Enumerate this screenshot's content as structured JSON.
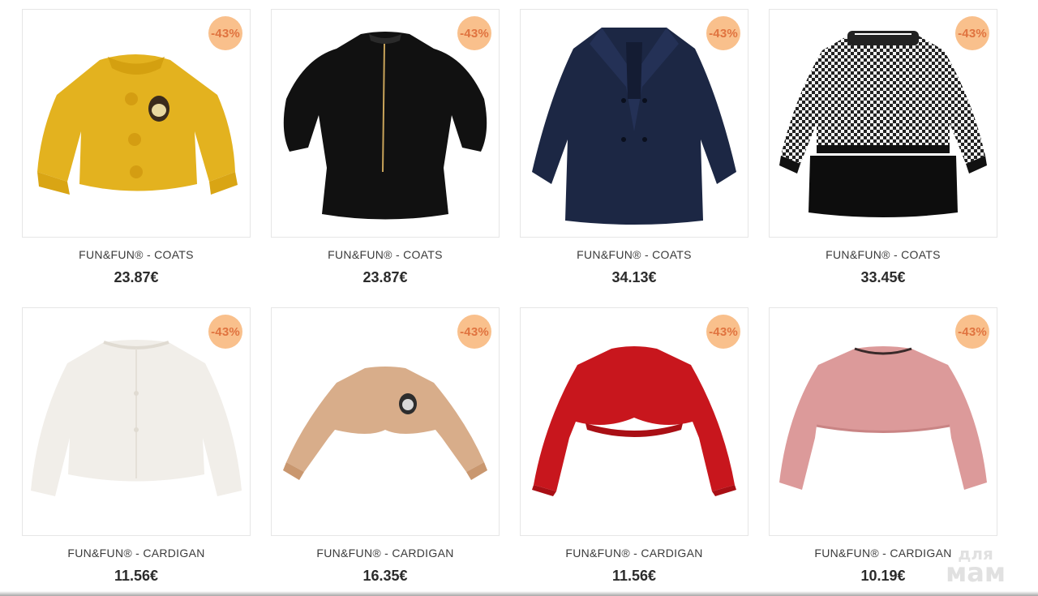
{
  "products": [
    {
      "title": "FUN&FUN® - COATS",
      "price": "23.87€",
      "discount": "-43%",
      "image": "yellow-teddy-coat",
      "color": "#e3b21f"
    },
    {
      "title": "FUN&FUN® - COATS",
      "price": "23.87€",
      "discount": "-43%",
      "image": "black-velvet-coat",
      "color": "#111111"
    },
    {
      "title": "FUN&FUN® - COATS",
      "price": "34.13€",
      "discount": "-43%",
      "image": "navy-peacoat",
      "color": "#1c2744"
    },
    {
      "title": "FUN&FUN® - COATS",
      "price": "33.45€",
      "discount": "-43%",
      "image": "houndstooth-fur-coat",
      "color": "#2a2a2a"
    },
    {
      "title": "FUN&FUN® - CARDIGAN",
      "price": "11.56€",
      "discount": "-43%",
      "image": "white-fluffy-cardigan",
      "color": "#f1eee9"
    },
    {
      "title": "FUN&FUN® - CARDIGAN",
      "price": "16.35€",
      "discount": "-43%",
      "image": "beige-knit-bolero",
      "color": "#d8ad8a"
    },
    {
      "title": "FUN&FUN® - CARDIGAN",
      "price": "11.56€",
      "discount": "-43%",
      "image": "red-ruffle-bolero",
      "color": "#c8161d"
    },
    {
      "title": "FUN&FUN® - CARDIGAN",
      "price": "10.19€",
      "discount": "-43%",
      "image": "pink-fluffy-cardigan",
      "color": "#dc9a9a"
    }
  ],
  "watermark": {
    "line1": "для",
    "line2": "мам"
  },
  "badge_color": "#f9c08c",
  "badge_text_color": "#e0733f"
}
